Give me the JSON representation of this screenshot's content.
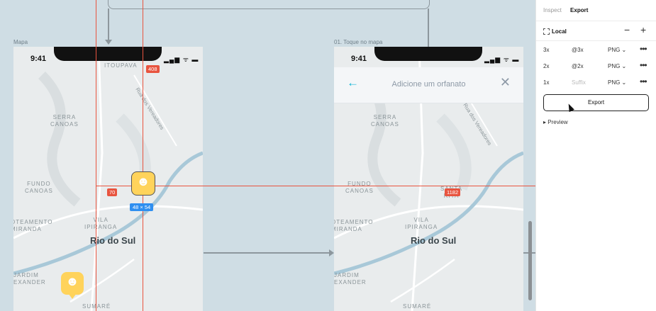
{
  "canvas": {
    "frames": [
      {
        "label": "Mapa",
        "time": "9:41",
        "status": "▂▄▆ ᯤ ▬",
        "map_labels": {
          "top": "ITOUPAVA",
          "serra": "SERRA\nCANOAS",
          "fundo": "FUNDO\nCANOAS",
          "vila": "VILA\nIPIRANGA",
          "oteamento": "OTEAMENTO\nMIRANDA",
          "jardim": "JARDIM\nEXANDER",
          "sumare": "SUMARÉ",
          "city": "Rio do Sul",
          "street": "Rua dos Vereadores"
        },
        "measurements": {
          "top_badge": "408",
          "left_badge": "70",
          "size_badge": "48 × 54"
        }
      },
      {
        "label": "01. Toque no mapa",
        "time": "9:41",
        "status": "▂▄▆ ᯤ ▬",
        "header_title": "Adicione um orfanato",
        "map_labels": {
          "serra": "SERRA\nCANOAS",
          "fundo": "FUNDO\nCANOAS",
          "santa": "SANTA\nRITA",
          "vila": "VILA\nIPIRANGA",
          "oteamento": "OTEAMENTO\nMIRANDA",
          "jardim": "JARDIM\nEXANDER",
          "sumare": "SUMARÉ",
          "city": "Rio do Sul",
          "street": "Rua dos Vereadores"
        },
        "measurements": {
          "right_badge": "1182"
        }
      }
    ]
  },
  "panel": {
    "tabs": [
      "Inspect",
      "Export"
    ],
    "active_tab": "Export",
    "section_title": "Local",
    "rows": [
      {
        "scale": "3x",
        "suffix": "@3x",
        "format": "PNG ⌄"
      },
      {
        "scale": "2x",
        "suffix": "@2x",
        "format": "PNG ⌄"
      },
      {
        "scale": "1x",
        "suffix": "Suffix",
        "format": "PNG ⌄"
      }
    ],
    "export_label": "Export",
    "preview_label": "▸  Preview"
  },
  "colors": {
    "accent_cyan": "#15b6d6",
    "measure_red": "#e8543f",
    "measure_blue": "#2f8ff0",
    "marker_yellow": "#ffd35b"
  }
}
